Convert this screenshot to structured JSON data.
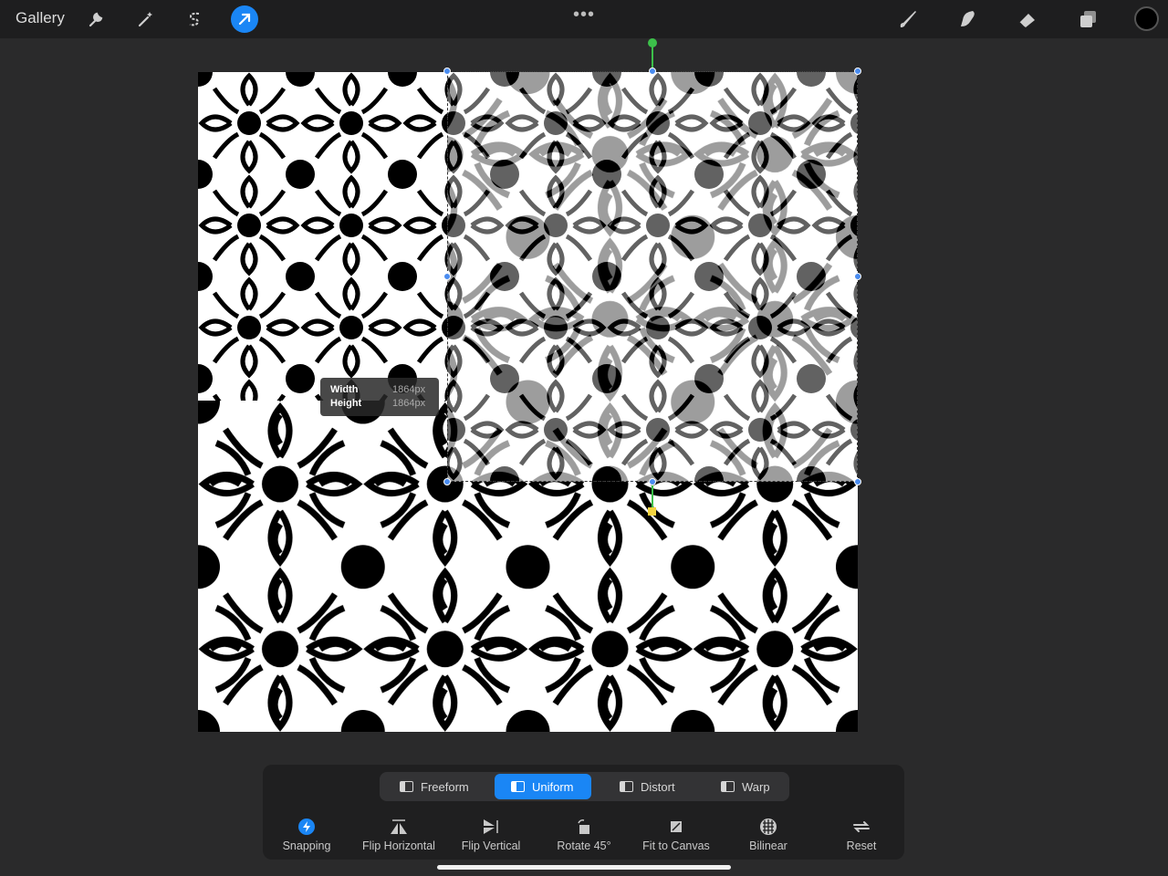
{
  "header": {
    "gallery_label": "Gallery",
    "tools_left": [
      "wrench-icon",
      "magic-wand-icon",
      "selection-s-icon",
      "transform-arrow-icon"
    ],
    "menu_dots": "•••",
    "tools_right": [
      "brush-icon",
      "smudge-icon",
      "eraser-icon",
      "layers-icon"
    ],
    "current_color": "#000000"
  },
  "transform": {
    "width_label": "Width",
    "height_label": "Height",
    "width_value": "1864px",
    "height_value": "1864px"
  },
  "modes": [
    {
      "label": "Freeform",
      "active": false
    },
    {
      "label": "Uniform",
      "active": true
    },
    {
      "label": "Distort",
      "active": false
    },
    {
      "label": "Warp",
      "active": false
    }
  ],
  "actions": [
    {
      "label": "Snapping",
      "icon": "snapping-icon"
    },
    {
      "label": "Flip Horizontal",
      "icon": "flip-horizontal-icon"
    },
    {
      "label": "Flip Vertical",
      "icon": "flip-vertical-icon"
    },
    {
      "label": "Rotate 45°",
      "icon": "rotate-icon"
    },
    {
      "label": "Fit to Canvas",
      "icon": "fit-canvas-icon"
    },
    {
      "label": "Bilinear",
      "icon": "bilinear-icon"
    },
    {
      "label": "Reset",
      "icon": "reset-icon"
    }
  ],
  "colors": {
    "accent": "#1a86f5",
    "rotation_handle": "#3cc04a",
    "pivot_handle": "#f2d340"
  }
}
